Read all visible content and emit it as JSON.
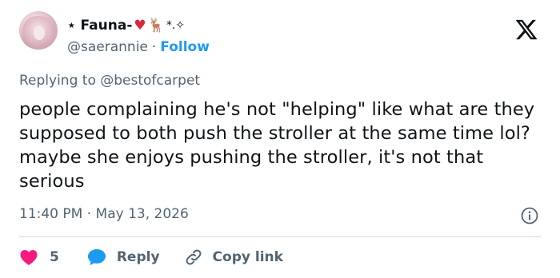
{
  "author": {
    "display_name": "⋆ Fauna-",
    "emoji_heart": "♥",
    "emoji_deer": "🦌",
    "emoji_sparkle": "*.✧",
    "handle": "@saerannie",
    "separator": "·",
    "follow_label": "Follow"
  },
  "reply": {
    "prefix": "Replying to",
    "target": "@bestofcarpet"
  },
  "tweet": {
    "text": "people complaining he's not \"helping\" like what are they supposed to both push the stroller at the same time lol? maybe she enjoys pushing the stroller, it's not that serious",
    "timestamp": "11:40 PM · May 13, 2026"
  },
  "actions": {
    "like_count": "5",
    "reply_label": "Reply",
    "copy_link_label": "Copy link"
  },
  "colors": {
    "like": "#f91880",
    "reply": "#1d9bf0",
    "follow": "#1d9bf0",
    "muted": "#536471"
  },
  "icons": {
    "brand": "x-logo-icon",
    "info": "info-icon",
    "like": "heart-icon",
    "reply": "speech-bubble-icon",
    "copy": "link-icon"
  }
}
